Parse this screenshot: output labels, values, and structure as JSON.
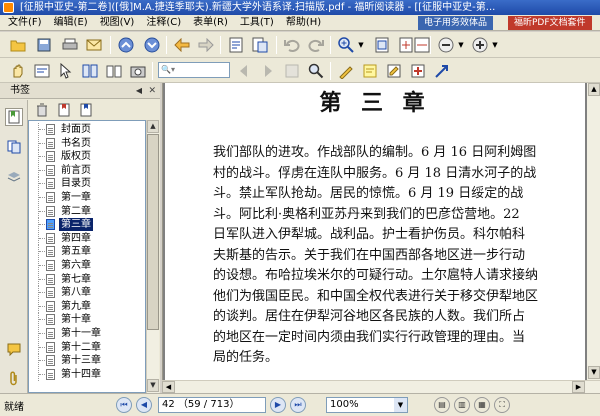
{
  "window": {
    "title": "[征服中亚史-第二卷]([俄]M.A.捷连季耶夫).新疆大学外语系译.扫描版.pdf - 福昕阅读器 - [[征服中亚史-第..."
  },
  "menu": {
    "items": [
      "文件(F)",
      "编辑(E)",
      "视图(V)",
      "注释(C)",
      "表单(R)",
      "工具(T)",
      "帮助(H)"
    ],
    "ad1": "电子用务效体品",
    "ad2": "福昕PDF文档套件"
  },
  "toolbar2": {
    "find_placeholder": ""
  },
  "sidebar": {
    "header": "书签",
    "bookmarks": [
      {
        "label": "封面页",
        "selected": false
      },
      {
        "label": "书名页",
        "selected": false
      },
      {
        "label": "版权页",
        "selected": false
      },
      {
        "label": "前言页",
        "selected": false
      },
      {
        "label": "目录页",
        "selected": false
      },
      {
        "label": "第一章",
        "selected": false
      },
      {
        "label": "第二章",
        "selected": false
      },
      {
        "label": "第三章",
        "selected": true
      },
      {
        "label": "第四章",
        "selected": false
      },
      {
        "label": "第五章",
        "selected": false
      },
      {
        "label": "第六章",
        "selected": false
      },
      {
        "label": "第七章",
        "selected": false
      },
      {
        "label": "第八章",
        "selected": false
      },
      {
        "label": "第九章",
        "selected": false
      },
      {
        "label": "第十章",
        "selected": false
      },
      {
        "label": "第十一章",
        "selected": false
      },
      {
        "label": "第十二章",
        "selected": false
      },
      {
        "label": "第十三章",
        "selected": false
      },
      {
        "label": "第十四章",
        "selected": false
      }
    ]
  },
  "document": {
    "chapter_title": "第 三 章",
    "lines": [
      "我们部队的进攻。作战部队的编制。6 月 16 日阿利姆图",
      "村的战斗。俘虏在连队中服务。6 月 18 日清水河子的战",
      "斗。禁止军队抢劫。居民的惊慌。6 月 19 日绥定的战",
      "斗。阿比利·奥格利亚苏丹来到我们的巴彦岱营地。22",
      "日军队进入伊犁城。战利品。护士看护伤员。科尔帕科",
      "夫斯基的告示。关于我们在中国西部各地区进一步行动",
      "的设想。布哈拉埃米尔的可疑行动。土尔扈特人请求接纳",
      "他们为俄国臣民。和中国全权代表进行关于移交伊犁地区",
      "的谈判。居住在伊犁河谷地区各民族的人数。我们所占",
      "的地区在一定时间内须由我们实行行政管理的理由。当",
      "局的任务。"
    ]
  },
  "status": {
    "text": "就绪",
    "page_value": "42 （59 / 713）",
    "zoom_value": "100%"
  }
}
